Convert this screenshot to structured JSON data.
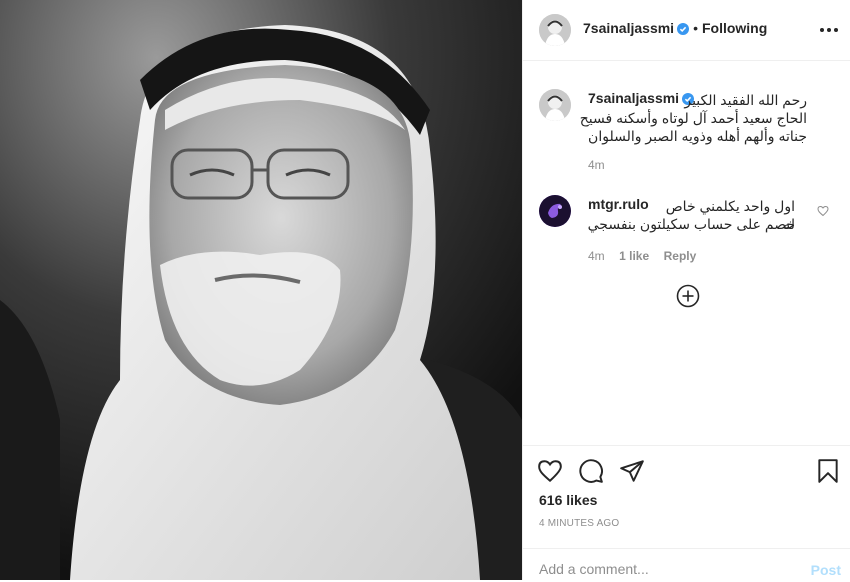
{
  "post": {
    "username": "7sainaljassmi",
    "follow_status": "Following",
    "caption_author": "7sainaljassmi",
    "caption_lines": [
      "رحم الله الفقيد الكبير",
      "الحاج سعيد أحمد آل لوتاه وأسكنه فسيح",
      "جناته وألهم أهله وذويه الصبر والسلوان"
    ],
    "caption_time": "4m",
    "likes": "616 likes",
    "posted_ago": "4 MINUTES AGO"
  },
  "comments": [
    {
      "username": "mtgr.rulo",
      "lines": [
        "اول واحد يكلمني خاص له",
        "خصم على حساب سكيلتون بنفسجي"
      ],
      "time": "4m",
      "likes": "1 like",
      "reply_label": "Reply"
    }
  ],
  "composer": {
    "placeholder": "Add a comment...",
    "post_label": "Post"
  },
  "icons": {
    "verified": "verified-badge-icon",
    "more": "more-options-icon",
    "like": "heart-icon",
    "comment": "comment-icon",
    "share": "share-icon",
    "save": "bookmark-icon",
    "load_more": "plus-circle-icon"
  },
  "colors": {
    "verified": "#3897f0",
    "post_disabled": "#b2dffc",
    "meta": "#8e8e8e",
    "comment_avatar": "#6a3fb5"
  }
}
